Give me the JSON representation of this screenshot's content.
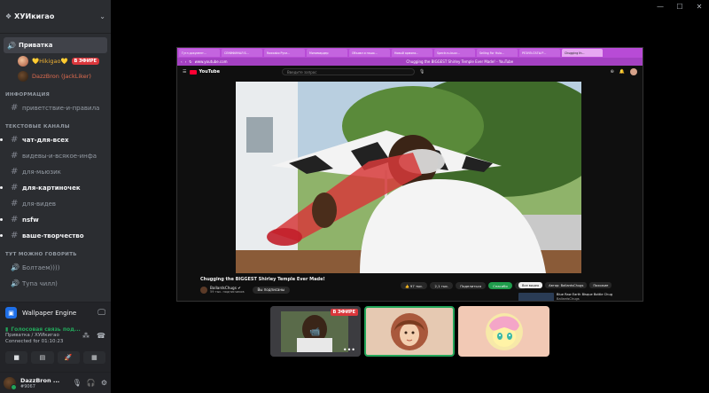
{
  "server": {
    "name": "ХУИкигао"
  },
  "voice_channel": {
    "name": "Приватка",
    "users": [
      {
        "name": "💛Hikigao💛",
        "badge": "В ЭФИРЕ"
      },
      {
        "name": "DazzBron (JackLiker)"
      }
    ]
  },
  "categories": {
    "info": "ИНФОРМАЦИЯ",
    "text": "ТЕКСТОВЫЕ КАНАЛЫ",
    "voice": "ТУТ МОЖНО ГОВОРИТЬ"
  },
  "channels": {
    "info": [
      {
        "name": "приветствие-и-правила"
      }
    ],
    "text": [
      {
        "name": "чат-для-всех"
      },
      {
        "name": "видевы-и-всякое-инфа"
      },
      {
        "name": "для-мьюзик"
      },
      {
        "name": "для-картиночек"
      },
      {
        "name": "для-видев"
      },
      {
        "name": "nsfw"
      },
      {
        "name": "ваше-творчество"
      }
    ],
    "voice": [
      {
        "name": "Болтаем))))"
      },
      {
        "name": "Тупа чилл)"
      }
    ]
  },
  "activity": {
    "name": "Wallpaper Engine"
  },
  "voice_status": {
    "status": "Голосовая связь под...",
    "location": "Приватка / ХУИкигао",
    "time": "Connected for 01:10:23"
  },
  "user": {
    "name": "DazzBron ...",
    "tag": "#9067"
  },
  "browser": {
    "tabs": [
      "Гугл документ...",
      "СЕМИФИНАЛ Б...",
      "Rawxabo Руче...",
      "Минимардер",
      "Объявл и нашо...",
      "Новый армяни...",
      "Spectr.ru.buzz...",
      "Selling For Hulo...",
      "РЕЗУЛЬТАТЫ Р...",
      "Chugging th..."
    ],
    "url": "www.youtube.com",
    "page_title": "Chugging the BIGGEST Shirley Temple Ever Made! - YouTube"
  },
  "youtube": {
    "logo": "YouTube",
    "search_placeholder": "Введите запрос",
    "video_title": "Chugging the BIGGEST Shirley Temple Ever Made!",
    "channel": "BallardsChugs ✔",
    "subscribers": "59 тыс. подписчиков",
    "subscribed": "Вы подписаны",
    "likes": "👍 97 тыс.",
    "comments": "2,1 тыс.",
    "share": "Поделиться",
    "thanks": "Спасибо",
    "more": "...",
    "chips": [
      "Все видео",
      "Автор: BallardsChugs",
      "Похожие"
    ],
    "rec_title": "Blue Raw Earth Bisque Bottle Chug",
    "rec_channel": "BallardsChugs"
  },
  "tiles": {
    "live_badge": "В ЭФИРЕ"
  },
  "colors": {
    "accent": "#5865f2",
    "green": "#23a55a",
    "live": "#da373c",
    "browser": "#b84bd6"
  }
}
